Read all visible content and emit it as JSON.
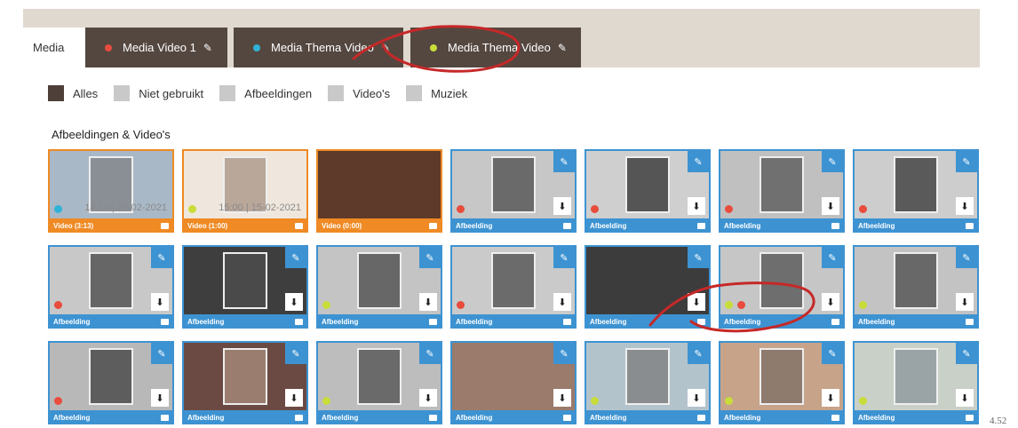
{
  "tabs": [
    {
      "label": "Media",
      "dot": null
    },
    {
      "label": "Media Video 1",
      "dot": "#e84c3d"
    },
    {
      "label": "Media Thema Video",
      "dot": "#2fb2d6"
    },
    {
      "label": "Media Thema Video",
      "dot": "#c9dd3a"
    }
  ],
  "filters": [
    {
      "label": "Alles",
      "active": true
    },
    {
      "label": "Niet gebruikt",
      "active": false
    },
    {
      "label": "Afbeeldingen",
      "active": false
    },
    {
      "label": "Video's",
      "active": false
    },
    {
      "label": "Muziek",
      "active": false
    }
  ],
  "section_title": "Afbeeldingen & Video's",
  "colors": {
    "tab_bg": "#544740",
    "card_blue": "#3d93d2",
    "card_orange": "#ef8a24",
    "red": "#e84c3d",
    "cyan": "#2fb2d6",
    "yellow": "#c9dd3a"
  },
  "cards": [
    {
      "type": "video",
      "label": "Video (3:13)",
      "time": "14:14 | 15-02-2021",
      "dots": [
        "#2fb2d6"
      ],
      "bg": "#a9b8c6",
      "photo": "#8a8f96",
      "full": false
    },
    {
      "type": "video",
      "label": "Video (1:00)",
      "time": "15:00 | 15-02-2021",
      "dots": [
        "#c9dd3a"
      ],
      "bg": "#efe7dd",
      "photo": "#b9a79a",
      "full": false
    },
    {
      "type": "video",
      "label": "Video (0:00)",
      "time": "",
      "dots": [],
      "bg": "#3a2418",
      "photo": "#5e3a2a",
      "full": true
    },
    {
      "type": "image",
      "label": "Afbeelding",
      "dots": [
        "#e84c3d"
      ],
      "bg": "#c7c7c7",
      "photo": "#6a6a6a",
      "full": false
    },
    {
      "type": "image",
      "label": "Afbeelding",
      "dots": [
        "#e84c3d"
      ],
      "bg": "#cfcfcf",
      "photo": "#555555",
      "full": false
    },
    {
      "type": "image",
      "label": "Afbeelding",
      "dots": [
        "#e84c3d"
      ],
      "bg": "#c0c0c0",
      "photo": "#707070",
      "full": false
    },
    {
      "type": "image",
      "label": "Afbeelding",
      "dots": [
        "#e84c3d"
      ],
      "bg": "#cdcdcd",
      "photo": "#5a5a5a",
      "full": false
    },
    {
      "type": "image",
      "label": "Afbeelding",
      "dots": [
        "#e84c3d"
      ],
      "bg": "#c8c8c8",
      "photo": "#666666",
      "full": false
    },
    {
      "type": "image",
      "label": "Afbeelding",
      "dots": [],
      "bg": "#3e3e3e",
      "photo": "#4a4a4a",
      "full": false
    },
    {
      "type": "image",
      "label": "Afbeelding",
      "dots": [
        "#c9dd3a"
      ],
      "bg": "#c4c4c4",
      "photo": "#676767",
      "full": false
    },
    {
      "type": "image",
      "label": "Afbeelding",
      "dots": [
        "#e84c3d"
      ],
      "bg": "#cacaca",
      "photo": "#6b6b6b",
      "full": false
    },
    {
      "type": "image",
      "label": "Afbeelding",
      "dots": [],
      "bg": "#4a4a4a",
      "photo": "#3c3c3c",
      "full": true
    },
    {
      "type": "image",
      "label": "Afbeelding",
      "dots": [
        "#c9dd3a",
        "#e84c3d"
      ],
      "bg": "#c6c6c6",
      "photo": "#6e6e6e",
      "full": false
    },
    {
      "type": "image",
      "label": "Afbeelding",
      "dots": [
        "#c9dd3a"
      ],
      "bg": "#c3c3c3",
      "photo": "#686868",
      "full": false
    },
    {
      "type": "image",
      "label": "Afbeelding",
      "dots": [
        "#e84c3d"
      ],
      "bg": "#b8b8b8",
      "photo": "#5d5d5d",
      "full": false
    },
    {
      "type": "image",
      "label": "Afbeelding",
      "dots": [],
      "bg": "#6b4a43",
      "photo": "#9a7d6e",
      "full": false
    },
    {
      "type": "image",
      "label": "Afbeelding",
      "dots": [
        "#c9dd3a"
      ],
      "bg": "#bdbdbd",
      "photo": "#6a6a6a",
      "full": false
    },
    {
      "type": "image",
      "label": "Afbeelding",
      "dots": [],
      "bg": "#b89684",
      "photo": "#9b7b6b",
      "full": true
    },
    {
      "type": "image",
      "label": "Afbeelding",
      "dots": [
        "#c9dd3a"
      ],
      "bg": "#b3c3cc",
      "photo": "#8a8d8f",
      "full": false
    },
    {
      "type": "image",
      "label": "Afbeelding",
      "dots": [
        "#c9dd3a"
      ],
      "bg": "#c6a389",
      "photo": "#8f7a6e",
      "full": false
    },
    {
      "type": "image",
      "label": "Afbeelding",
      "dots": [
        "#c9dd3a"
      ],
      "bg": "#c9d0c8",
      "photo": "#9aa4a6",
      "full": false
    }
  ],
  "page_number": "4.52"
}
